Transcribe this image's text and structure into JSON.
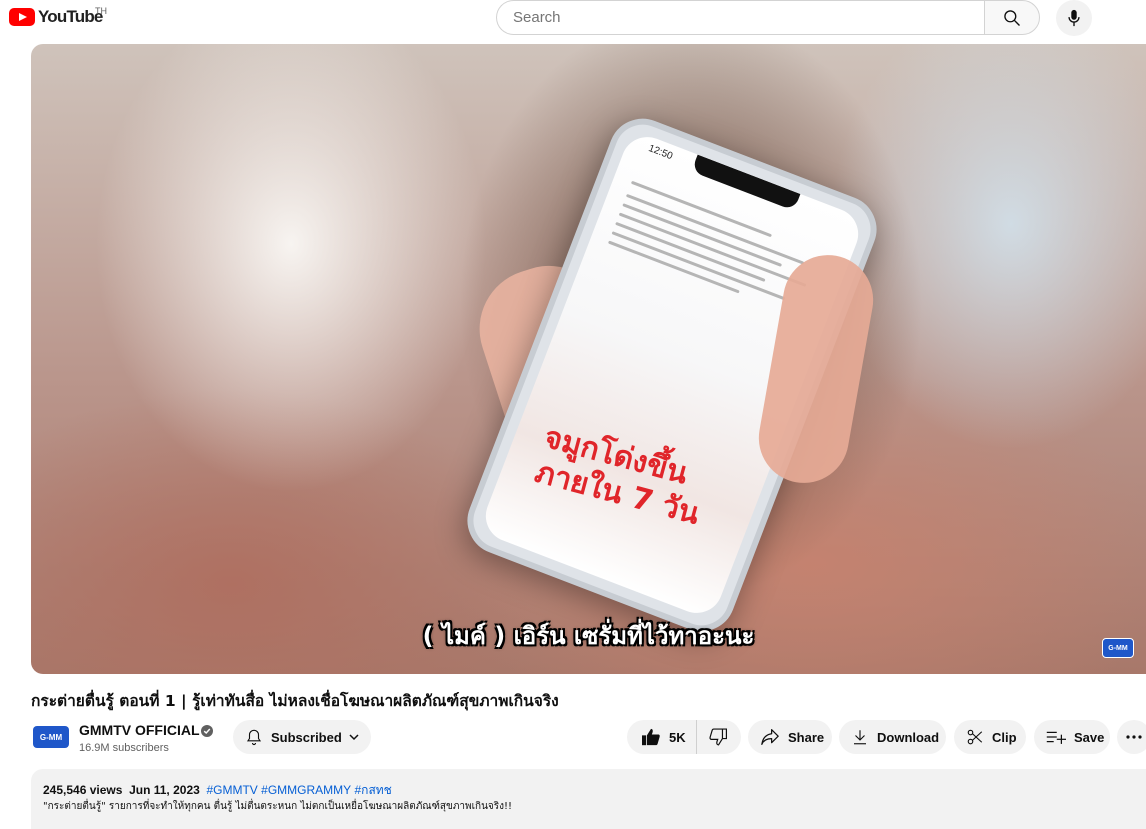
{
  "header": {
    "logo_text": "YouTube",
    "country_code": "TH",
    "search_placeholder": "Search",
    "search_value": ""
  },
  "video": {
    "subtitle": "( ไมค์ ) เอิร์น เซรั่มที่ไว้ทาอะนะ",
    "watermark": "G-MM",
    "phone_clock": "12:50",
    "phone_promo_line1": "จมูกโด่งขึ้น",
    "phone_promo_line2": "ภายใน 7 วัน"
  },
  "title": "กระต่ายตื่นรู้ ตอนที่ 1 | รู้เท่าทันสื่อ ไม่หลงเชื่อโฆษณาผลิตภัณฑ์สุขภาพเกินจริง",
  "channel": {
    "avatar_text": "G-MM",
    "name": "GMMTV OFFICIAL",
    "subscribers": "16.9M subscribers",
    "subscribed_label": "Subscribed"
  },
  "actions": {
    "like_count": "5K",
    "share_label": "Share",
    "download_label": "Download",
    "clip_label": "Clip",
    "save_label": "Save"
  },
  "description": {
    "views": "245,546 views",
    "date": "Jun 11, 2023",
    "tags": [
      "#GMMTV",
      "#GMMGRAMMY",
      "#กสทช"
    ],
    "text": "\"กระต่ายตื่นรู้\" รายการที่จะทำให้ทุกคน ตื่นรู้ ไม่ตื่นตระหนก ไม่ตกเป็นเหยื่อโฆษณาผลิตภัณฑ์สุขภาพเกินจริง!!"
  },
  "colors": {
    "brand_red": "#ff0000",
    "link_blue": "#065fd4",
    "pill_bg": "#f2f2f2"
  }
}
